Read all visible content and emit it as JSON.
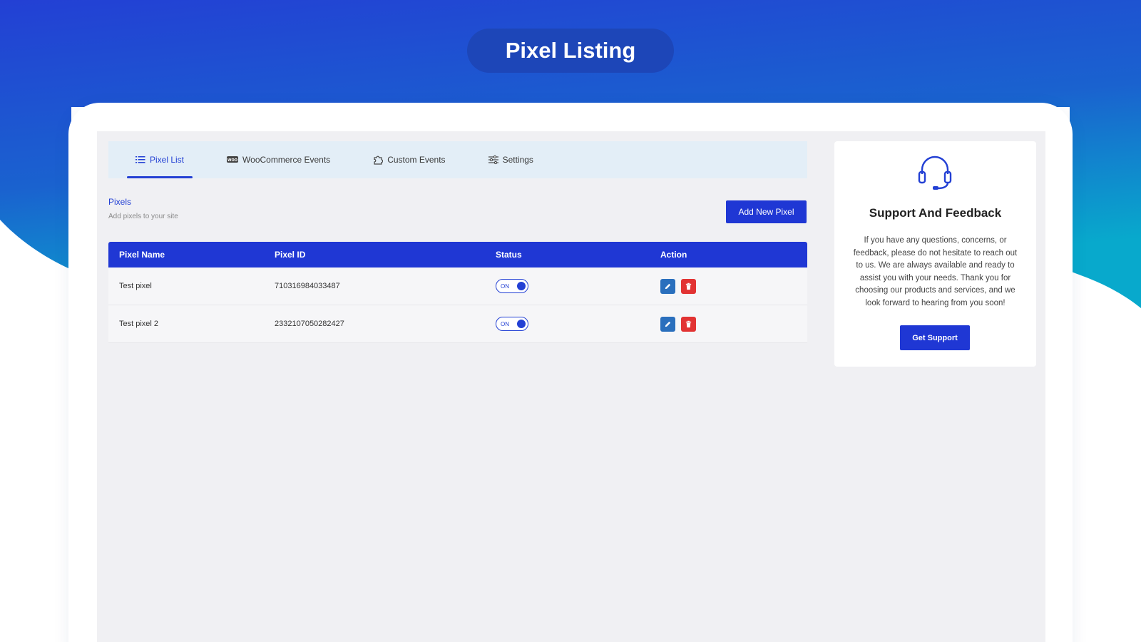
{
  "page": {
    "title": "Pixel Listing"
  },
  "tabs": [
    {
      "label": "Pixel List",
      "icon": "list-icon",
      "active": true
    },
    {
      "label": "WooCommerce Events",
      "icon": "woo-icon",
      "active": false
    },
    {
      "label": "Custom Events",
      "icon": "puzzle-icon",
      "active": false
    },
    {
      "label": "Settings",
      "icon": "sliders-icon",
      "active": false
    }
  ],
  "pixels": {
    "title": "Pixels",
    "subtitle": "Add pixels to your site",
    "add_button": "Add New Pixel"
  },
  "table": {
    "headers": [
      "Pixel Name",
      "Pixel ID",
      "Status",
      "Action"
    ],
    "rows": [
      {
        "name": "Test pixel",
        "id": "710316984033487",
        "status": "ON"
      },
      {
        "name": "Test pixel 2",
        "id": "2332107050282427",
        "status": "ON"
      }
    ]
  },
  "support": {
    "icon": "headset-icon",
    "title": "Support And Feedback",
    "text": "If you have any questions, concerns, or feedback, please do not hesitate to reach out to us. We are always available and ready to assist you with your needs. Thank you for choosing our products and services, and we look forward to hearing from you soon!",
    "button": "Get Support"
  },
  "colors": {
    "primary": "#1f37d4",
    "edit": "#2a6fbd",
    "delete": "#e23333",
    "gradient_top": "#2340d4",
    "gradient_bottom": "#0aa5cf"
  }
}
